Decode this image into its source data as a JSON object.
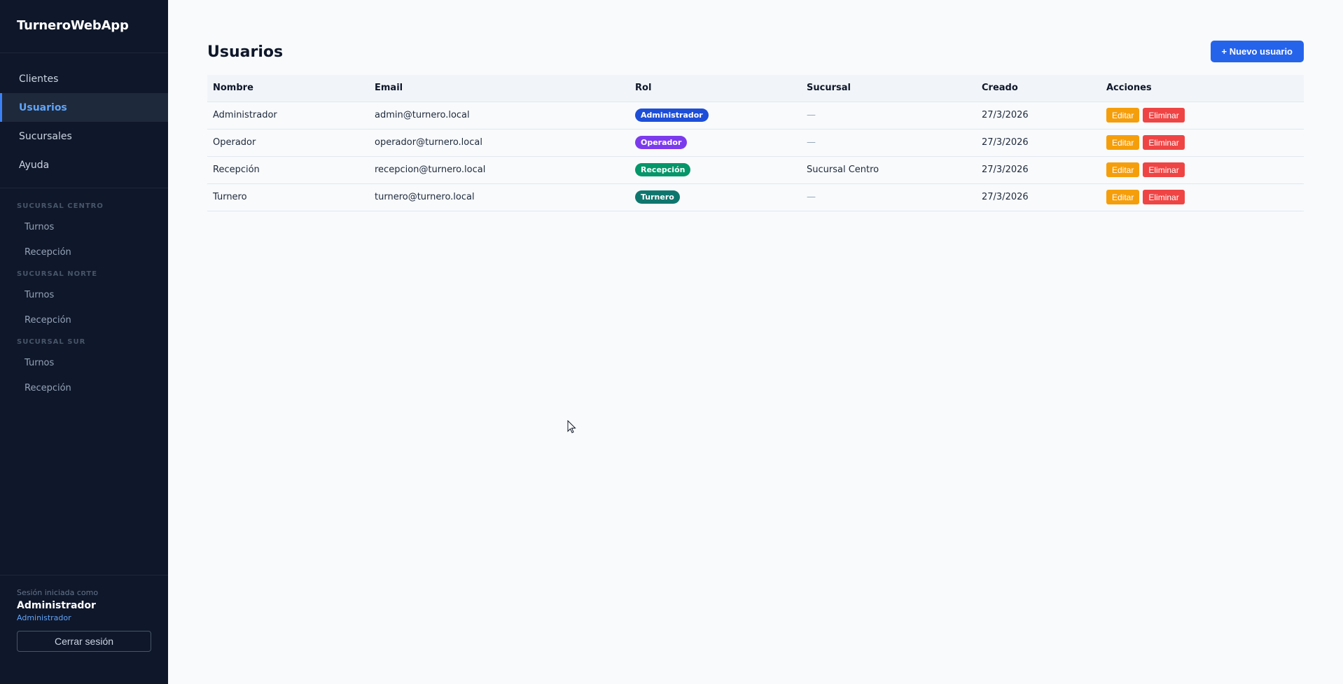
{
  "app": {
    "title": "TurneroWebApp"
  },
  "sidebar": {
    "nav": [
      {
        "label": "Clientes",
        "active": false
      },
      {
        "label": "Usuarios",
        "active": true
      },
      {
        "label": "Sucursales",
        "active": false
      },
      {
        "label": "Ayuda",
        "active": false
      }
    ],
    "branches": [
      {
        "title": "SUCURSAL CENTRO",
        "links": [
          "Turnos",
          "Recepción"
        ]
      },
      {
        "title": "SUCURSAL NORTE",
        "links": [
          "Turnos",
          "Recepción"
        ]
      },
      {
        "title": "SUCURSAL SUR",
        "links": [
          "Turnos",
          "Recepción"
        ]
      }
    ],
    "footer": {
      "session_label": "Sesión iniciada como",
      "user_name": "Administrador",
      "user_role": "Administrador",
      "logout_label": "Cerrar sesión"
    }
  },
  "main": {
    "title": "Usuarios",
    "new_button": "+ Nuevo usuario",
    "table": {
      "columns": [
        "Nombre",
        "Email",
        "Rol",
        "Sucursal",
        "Creado",
        "Acciones"
      ],
      "rows": [
        {
          "nombre": "Administrador",
          "email": "admin@turnero.local",
          "rol": "Administrador",
          "rol_color": "#1d4ed8",
          "sucursal": "—",
          "creado": "27/3/2026",
          "edit": "Editar",
          "delete": "Eliminar"
        },
        {
          "nombre": "Operador",
          "email": "operador@turnero.local",
          "rol": "Operador",
          "rol_color": "#7c3aed",
          "sucursal": "—",
          "creado": "27/3/2026",
          "edit": "Editar",
          "delete": "Eliminar"
        },
        {
          "nombre": "Recepción",
          "email": "recepcion@turnero.local",
          "rol": "Recepción",
          "rol_color": "#059669",
          "sucursal": "Sucursal Centro",
          "creado": "27/3/2026",
          "edit": "Editar",
          "delete": "Eliminar"
        },
        {
          "nombre": "Turnero",
          "email": "turnero@turnero.local",
          "rol": "Turnero",
          "rol_color": "#0f766e",
          "sucursal": "—",
          "creado": "27/3/2026",
          "edit": "Editar",
          "delete": "Eliminar"
        }
      ]
    }
  },
  "colors": {
    "edit_button": "#f59e0b",
    "delete_button": "#ef4444",
    "primary": "#2563eb",
    "sidebar_bg": "#0f172a"
  }
}
